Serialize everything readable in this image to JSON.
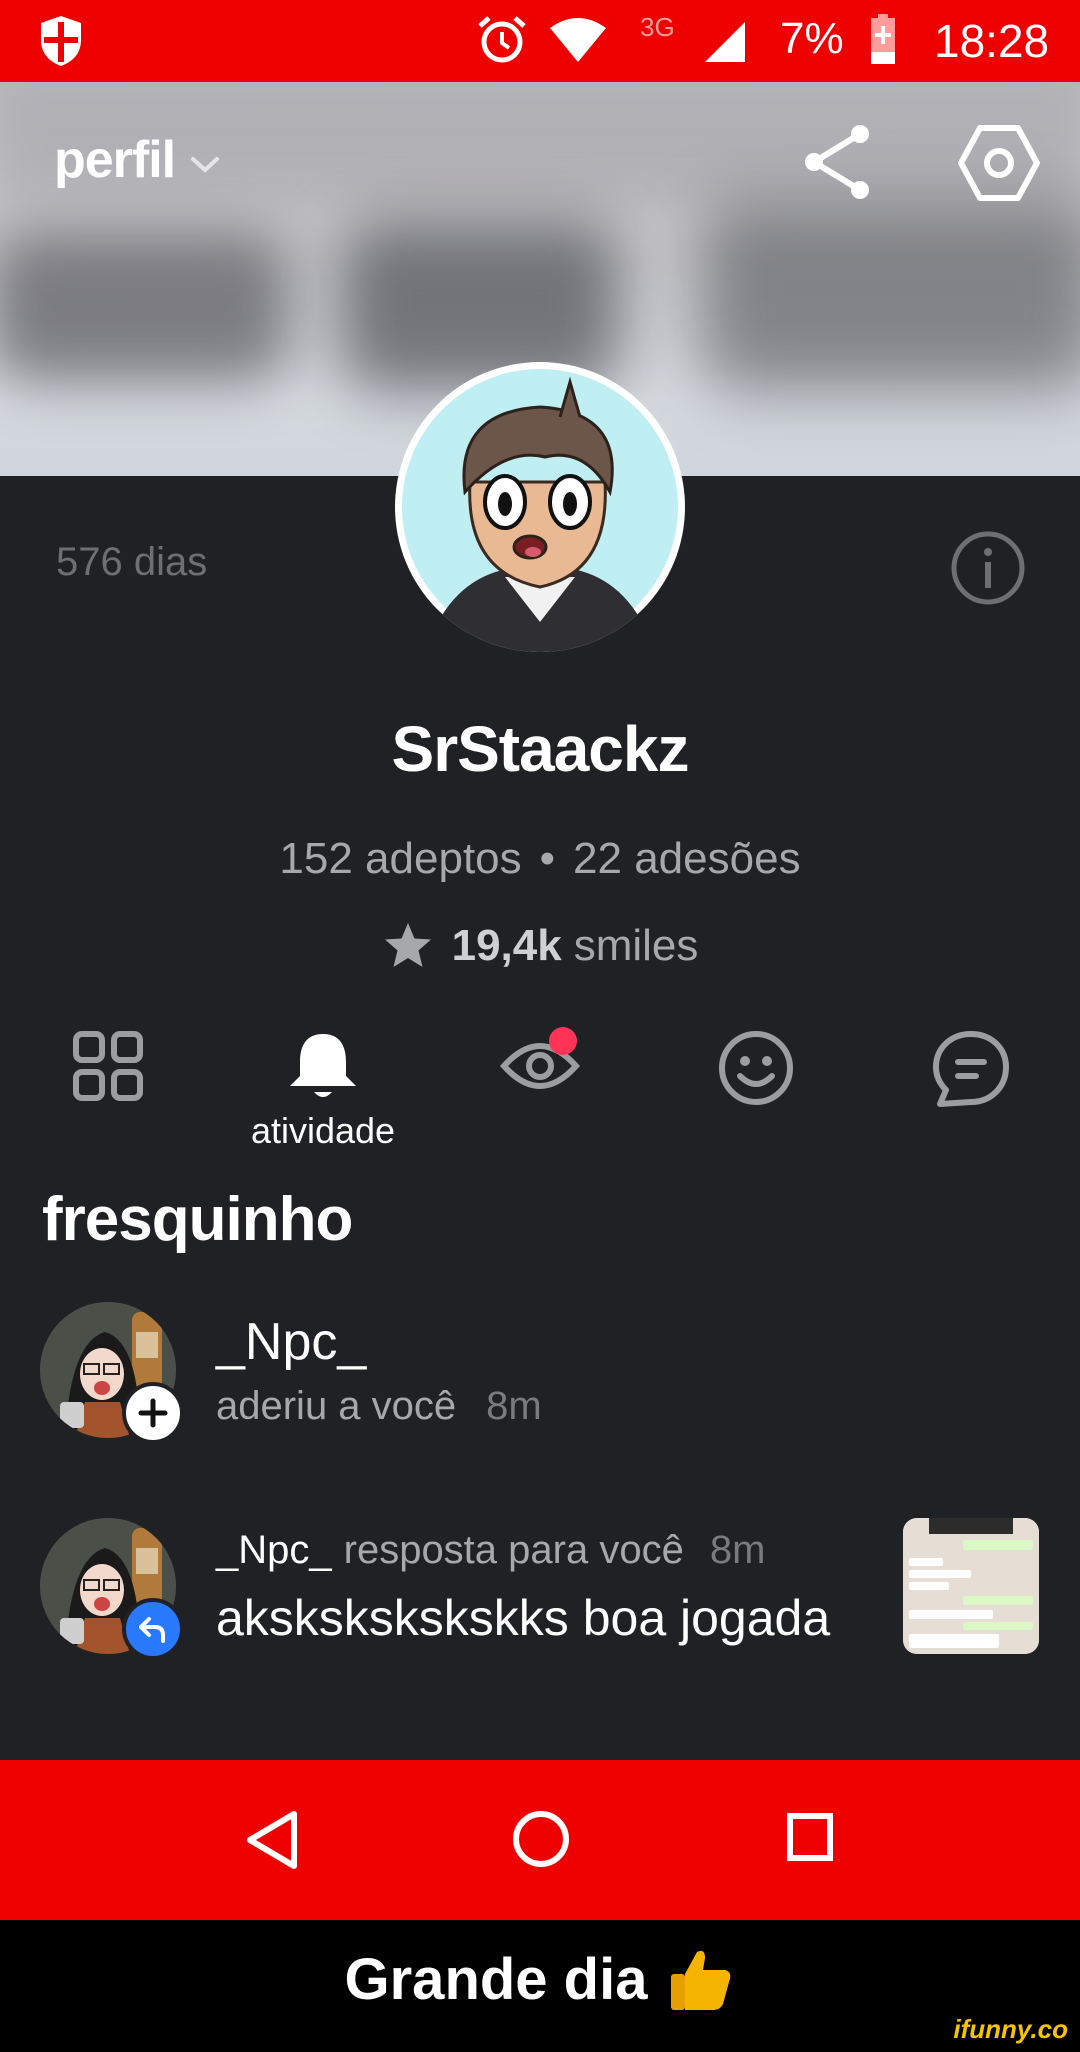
{
  "status_bar": {
    "network": "3G",
    "battery_percent": "7%",
    "time": "18:28",
    "icons": [
      "shield-icon",
      "alarm-icon",
      "wifi-icon",
      "signal-icon",
      "battery-charging-icon"
    ],
    "background_color": "#ee0000"
  },
  "header": {
    "title": "perfil",
    "icons": [
      "chevron-down-icon",
      "share-icon",
      "settings-icon"
    ]
  },
  "profile": {
    "days": "576 dias",
    "username": "SrStaackz",
    "followers": "152 adeptos",
    "separator": "•",
    "following": "22 adesões",
    "smiles_count": "19,4k",
    "smiles_label": "smiles"
  },
  "tabs": {
    "items": [
      "grid-icon",
      "bell-icon",
      "eye-icon",
      "smile-icon",
      "chat-icon"
    ],
    "active_label": "atividade",
    "notification_dot_color": "#ff3355"
  },
  "section": {
    "title": "fresquinho"
  },
  "activity": [
    {
      "user": "_Npc_",
      "text": "aderiu a você",
      "time": "8m",
      "badge_icon": "plus-icon"
    },
    {
      "user": "_Npc_",
      "text": "resposta para você",
      "time": "8m",
      "message": "akskskskskskks boa jogada",
      "badge_icon": "reply-icon"
    }
  ],
  "navigation": {
    "buttons": [
      "back-icon",
      "home-icon",
      "recents-icon"
    ]
  },
  "caption": {
    "text": "Grande dia",
    "emoji": "👍",
    "watermark": "ifunny.co"
  },
  "colors": {
    "accent_red": "#ee0000",
    "dark_background": "#202124",
    "muted_text": "#a7a8ab",
    "reply_blue": "#2979ff",
    "watermark_yellow": "#f6c500"
  }
}
